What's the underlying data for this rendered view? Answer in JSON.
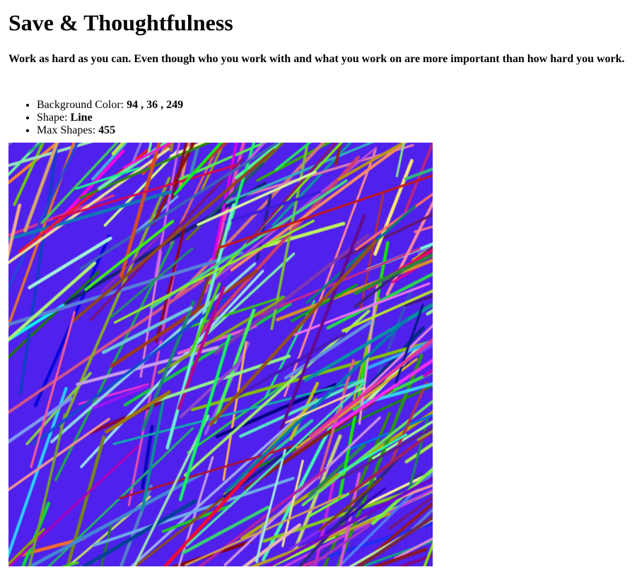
{
  "page": {
    "title": "Save & Thoughtfulness",
    "subtitle": "Work as hard as you can. Even though who you work with and what you work on are more important than how hard you work."
  },
  "settings": [
    {
      "label": "Background Color: ",
      "value": "94 , 36 , 249"
    },
    {
      "label": "Shape: ",
      "value": "Line"
    },
    {
      "label": "Max Shapes: ",
      "value": "455"
    }
  ],
  "artwork": {
    "background_color": "#5e24f9",
    "shape": "line",
    "max_shapes": 455
  }
}
